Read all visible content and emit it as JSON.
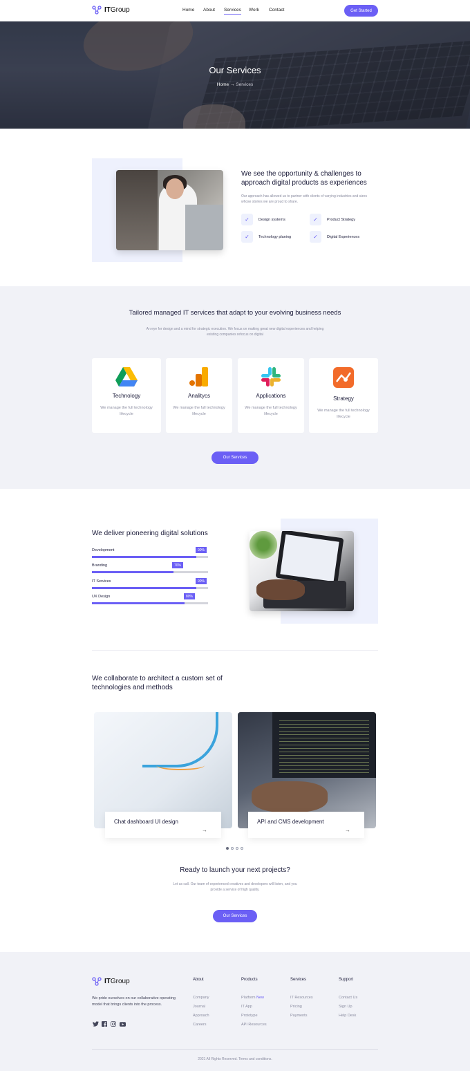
{
  "brand": {
    "name_bold": "IT",
    "name_rest": "Group",
    "accent": "#6b5ff5",
    "logo_icon": "molecule-logo-icon"
  },
  "nav": {
    "links": [
      "Home",
      "About",
      "Services",
      "Work",
      "Contact"
    ],
    "active": "Services",
    "cta": "Get Started"
  },
  "hero": {
    "title": "Our Services",
    "breadcrumb": {
      "home": "Home",
      "arrow_icon": "arrow-right-icon",
      "current": "Services"
    }
  },
  "intro": {
    "heading": "We see the opportunity & challenges to approach digital products as experiences",
    "text": "Our approach has allowed us to partner with clients of varying industries and sizes whose stories we are proud to share.",
    "features": [
      "Design systems",
      "Product Strategy",
      "Technology planing",
      "Digital Experiences"
    ],
    "check_icon": "check-icon"
  },
  "managed": {
    "heading": "Tailored managed IT services that adapt to your evolving business needs",
    "text": "An eye for design and a mind for strategic execution. We focus on making great new digital experiences and helping existing companies refocus on digital",
    "cards": [
      {
        "title": "Technology",
        "desc": "We manage the full technology lifecycle",
        "icon": "google-drive-icon"
      },
      {
        "title": "Analitycs",
        "desc": "We manage the full technology lifecycle",
        "icon": "analytics-icon"
      },
      {
        "title": "Applications",
        "desc": "We manage the full technology lifecycle",
        "icon": "slack-icon"
      },
      {
        "title": "Strategy",
        "desc": "We manage the full technology lifecycle",
        "icon": "strategy-chart-icon"
      }
    ],
    "button": "Our Services"
  },
  "skills": {
    "heading": "We deliver pioneering digital solutions",
    "bars": [
      {
        "label": "Development",
        "value": 90,
        "tag": "90%"
      },
      {
        "label": "Branding",
        "value": 70,
        "tag": "70%"
      },
      {
        "label": "IT Services",
        "value": 90,
        "tag": "90%"
      },
      {
        "label": "UX Design",
        "value": 80,
        "tag": "80%"
      }
    ]
  },
  "projects": {
    "heading": "We collaborate to architect a custom set of technologies and methods",
    "items": [
      {
        "title": "Chat dashboard UI design",
        "arrow_icon": "arrow-right-icon"
      },
      {
        "title": "API and CMS development",
        "arrow_icon": "arrow-right-icon"
      }
    ],
    "dots": 4,
    "active_dot": 0
  },
  "cta": {
    "heading": "Ready to launch your next projects?",
    "text": "Let us call. Our team of experienced creatives and developers will listen, and you provide a service of high quality.",
    "button": "Our Services"
  },
  "footer": {
    "about": "We pride ourselves on our collaborative operating model that brings clients into the process.",
    "social_icons": [
      "twitter-icon",
      "facebook-icon",
      "instagram-icon",
      "youtube-icon"
    ],
    "columns": [
      {
        "heading": "About",
        "links": [
          "Company",
          "Journal",
          "Approach",
          "Careers"
        ]
      },
      {
        "heading": "Products",
        "links": [
          "Platform",
          "IT App",
          "Prototype",
          "API Resources"
        ],
        "badge": "New"
      },
      {
        "heading": "Services",
        "links": [
          "IT Resources",
          "Pricing",
          "Payments"
        ]
      },
      {
        "heading": "Support",
        "links": [
          "Contact Us",
          "Sign Up",
          "Help Desk"
        ]
      }
    ],
    "copyright": "2021 All Rights Reserved. Terms and conditions."
  }
}
